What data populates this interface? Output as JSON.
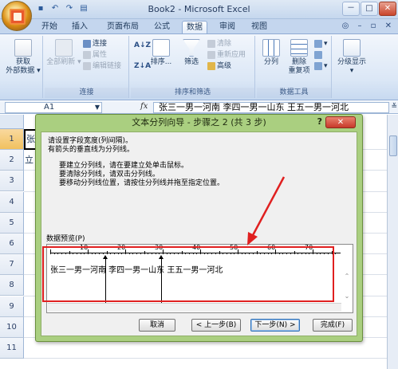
{
  "app": {
    "title": "Book2 - Microsoft Excel",
    "window_controls": [
      "－",
      "□",
      "✕"
    ],
    "qat_icons": [
      "save-icon",
      "undo-icon",
      "redo-icon",
      "print-preview-icon"
    ]
  },
  "ribbon": {
    "tabs": [
      "开始",
      "插入",
      "页面布局",
      "公式",
      "数据",
      "审阅",
      "视图"
    ],
    "active_tab": "数据",
    "right_controls": "◎ – ▫ ✕",
    "groups": {
      "get_external": {
        "label": "获取\n外部数据",
        "button": "获取",
        "button2": "外部数据 ▾"
      },
      "connections": {
        "label": "连接",
        "refresh_all": "全部刷新",
        "items": [
          "连接",
          "属性",
          "编辑链接"
        ]
      },
      "sort_filter": {
        "label": "排序和筛选",
        "sort": "排序...",
        "filter": "筛选",
        "items": [
          "清除",
          "重新应用",
          "高级"
        ]
      },
      "data_tools": {
        "label": "数据工具",
        "split": "分列",
        "remove_dup": "删除\n重复项"
      },
      "outline": {
        "label": "",
        "button": "分级显示"
      }
    }
  },
  "formula_bar": {
    "name_box": "A1",
    "fx": "fx",
    "content": "张三一男一河南 李四一男一山东 王五一男一河北"
  },
  "grid": {
    "rows": [
      "1",
      "2",
      "3",
      "4",
      "5",
      "6",
      "7",
      "8",
      "9",
      "10",
      "11"
    ],
    "a1_text": "张",
    "a2_text": "立"
  },
  "dialog": {
    "title": "文本分列向导 - 步骤之 2 (共 3 步)",
    "help": "?",
    "close": "✕",
    "instructions": [
      "请设置字段宽度(列间隔)。",
      "有箭头的垂直线为分列线。"
    ],
    "bullets": [
      "要建立分列线，请在要建立处单击鼠标。",
      "要清除分列线，请双击分列线。",
      "要移动分列线位置，请按住分列线并拖至指定位置。"
    ],
    "preview_label": "数据预览(P)",
    "ruler_numbers": [
      "10",
      "20",
      "30",
      "40",
      "50",
      "60",
      "70"
    ],
    "preview_text": "张三一男一河南 李四一男一山东 王五一男一河北",
    "buttons": {
      "cancel": "取消",
      "back": "< 上一步(B)",
      "next": "下一步(N) >",
      "finish": "完成(F)"
    }
  },
  "colors": {
    "dialog_frame": "#aacf80",
    "highlight_red": "#e02020"
  }
}
